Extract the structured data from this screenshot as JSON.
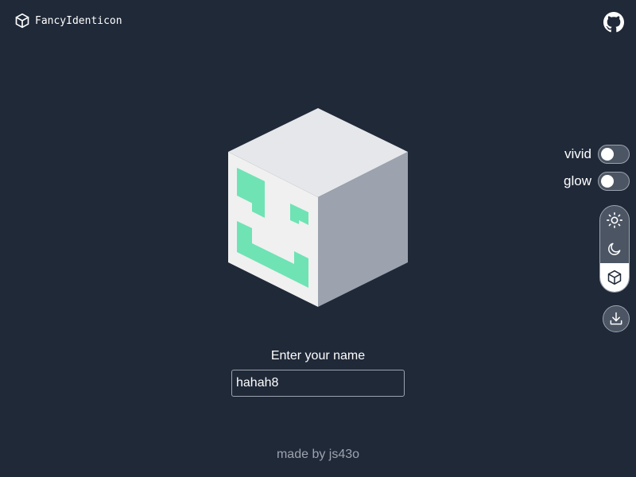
{
  "header": {
    "app_title": "FancyIdenticon",
    "logo_icon": "cube-icon",
    "github_icon": "github-icon"
  },
  "identicon": {
    "pattern_color": "#6fe3b4",
    "face_color": "#f0f0f0",
    "top_color": "#e5e7eb",
    "side_color": "#9ca3af"
  },
  "controls": {
    "vivid_label": "vivid",
    "vivid_on": false,
    "glow_label": "glow",
    "glow_on": false,
    "theme_options": [
      "light",
      "dark",
      "3d"
    ],
    "theme_selected": "3d",
    "download_icon": "download-icon"
  },
  "form": {
    "label": "Enter your name",
    "value": "hahah8"
  },
  "footer": {
    "text": "made by js43o"
  }
}
